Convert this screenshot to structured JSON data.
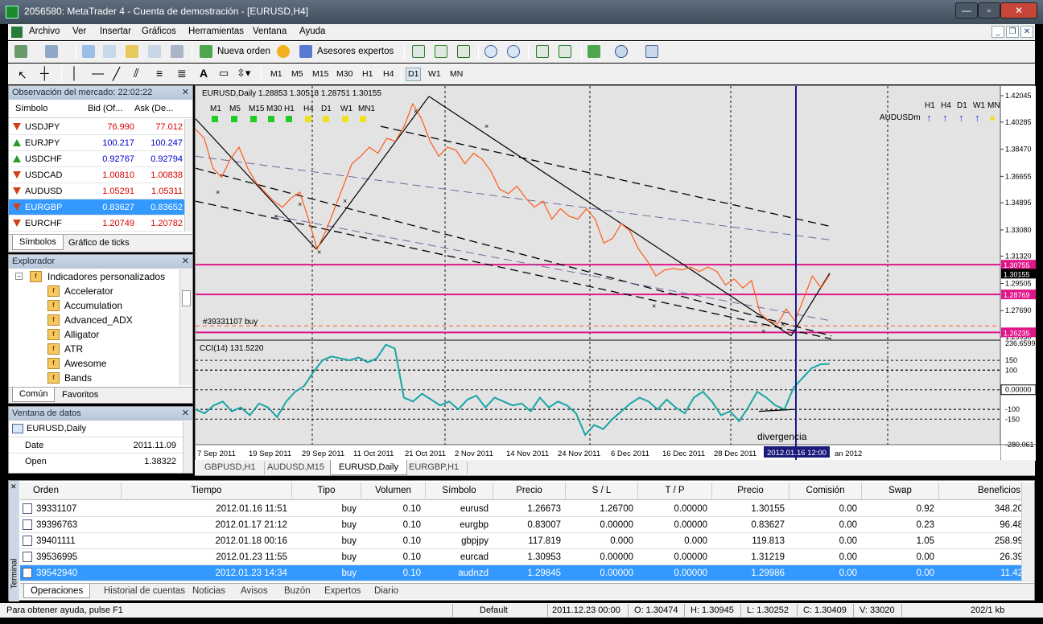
{
  "app": {
    "title": "2056580: MetaTrader 4 - Cuenta de demostración - [EURUSD,H4]"
  },
  "menu": [
    "Archivo",
    "Ver",
    "Insertar",
    "Gráficos",
    "Herramientas",
    "Ventana",
    "Ayuda"
  ],
  "toolbar": {
    "new_order": "Nueva orden",
    "experts": "Asesores expertos",
    "timeframes": [
      "M1",
      "M5",
      "M15",
      "M30",
      "H1",
      "H4",
      "D1",
      "W1",
      "MN"
    ]
  },
  "market_watch": {
    "title": "Observación del mercado: 22:02:22",
    "col_symbol": "Símbolo",
    "col_bid": "Bid (Of...",
    "col_ask": "Ask (De...",
    "rows": [
      {
        "symbol": "USDJPY",
        "bid": "76.990",
        "ask": "77.012",
        "dir": "down",
        "color": "#d80000"
      },
      {
        "symbol": "EURJPY",
        "bid": "100.217",
        "ask": "100.247",
        "dir": "up",
        "color": "#0000c8"
      },
      {
        "symbol": "USDCHF",
        "bid": "0.92767",
        "ask": "0.92794",
        "dir": "up",
        "color": "#0000c8"
      },
      {
        "symbol": "USDCAD",
        "bid": "1.00810",
        "ask": "1.00838",
        "dir": "down",
        "color": "#d80000"
      },
      {
        "symbol": "AUDUSD",
        "bid": "1.05291",
        "ask": "1.05311",
        "dir": "down",
        "color": "#d80000"
      },
      {
        "symbol": "EURGBP",
        "bid": "0.83627",
        "ask": "0.83652",
        "dir": "down",
        "color": "#ffffff"
      },
      {
        "symbol": "EURCHF",
        "bid": "1.20749",
        "ask": "1.20782",
        "dir": "down",
        "color": "#d80000"
      }
    ],
    "tab_symbols": "Símbolos",
    "tab_ticks": "Gráfico de ticks"
  },
  "navigator": {
    "title": "Explorador",
    "folder": "Indicadores personalizados",
    "items": [
      "Accelerator",
      "Accumulation",
      "Advanced_ADX",
      "Alligator",
      "ATR",
      "Awesome",
      "Bands"
    ],
    "tab_common": "Común",
    "tab_favorites": "Favoritos"
  },
  "data_window": {
    "title": "Ventana de datos",
    "symbol": "EURUSD,Daily",
    "rows": [
      {
        "label": "Date",
        "value": "2011.11.09"
      },
      {
        "label": "Open",
        "value": "1.38322"
      }
    ]
  },
  "chart": {
    "header": "EURUSD,Daily  1.28853 1.30518 1.28751 1.30155",
    "tf_labels": [
      "M1",
      "M5",
      "M15",
      "M30",
      "H1",
      "H4",
      "D1",
      "W1",
      "MN1"
    ],
    "audusd_label": "AUDUSDm",
    "audusd_tfs": [
      "H1",
      "H4",
      "D1",
      "W1",
      "MN"
    ],
    "order_label": "#39331107 buy",
    "price_ticks": [
      "1.42045",
      "1.40285",
      "1.38470",
      "1.36655",
      "1.34895",
      "1.33080",
      "1.31320",
      "1.29505",
      "1.27690",
      "1.25930"
    ],
    "price_tags": [
      {
        "text": "1.30755",
        "bg": "#e0168a"
      },
      {
        "text": "1.30155",
        "bg": "#000000"
      },
      {
        "text": "1.28769",
        "bg": "#e0168a"
      },
      {
        "text": "1.26235",
        "bg": "#e0168a"
      }
    ],
    "cci_label": "CCI(14) 131.5220",
    "cci_ticks": [
      "236.6599",
      "150",
      "100",
      "0.00000",
      "-100",
      "-150",
      "-280.061"
    ],
    "divergence": "divergencia",
    "date_ticks": [
      "7 Sep 2011",
      "19 Sep 2011",
      "29 Sep 2011",
      "11 Oct 2011",
      "21 Oct 2011",
      "2 Nov 2011",
      "14 Nov 2011",
      "24 Nov 2011",
      "6 Dec 2011",
      "16 Dec 2011",
      "28 Dec 2011",
      "an 2012"
    ],
    "cursor_date": "2012.01.16 12:00",
    "tabs": [
      "GBPUSD,H1",
      "AUDUSD,M15",
      "EURUSD,Daily",
      "EURGBP,H1"
    ],
    "active_tab": 2
  },
  "chart_data": {
    "type": "line",
    "title": "EURUSD,Daily",
    "ylim": [
      1.2593,
      1.42045
    ],
    "series": [
      {
        "name": "EURUSD",
        "values": [
          1.398,
          1.392,
          1.372,
          1.366,
          1.378,
          1.386,
          1.372,
          1.362,
          1.356,
          1.35,
          1.346,
          1.352,
          1.356,
          1.338,
          1.318,
          1.33,
          1.345,
          1.36,
          1.375,
          1.38,
          1.386,
          1.382,
          1.392,
          1.39,
          1.4,
          1.415,
          1.405,
          1.39,
          1.38,
          1.386,
          1.384,
          1.375,
          1.382,
          1.378,
          1.37,
          1.358,
          1.355,
          1.36,
          1.352,
          1.346,
          1.35,
          1.338,
          1.345,
          1.34,
          1.338,
          1.345,
          1.338,
          1.322,
          1.325,
          1.335,
          1.33,
          1.318,
          1.31,
          1.3,
          1.304,
          1.305,
          1.304,
          1.306,
          1.303,
          1.306,
          1.303,
          1.294,
          1.298,
          1.292,
          1.297,
          1.275,
          1.27,
          1.268,
          1.278,
          1.27,
          1.285,
          1.3,
          1.292,
          1.301
        ]
      },
      {
        "name": "CCI(14)",
        "values": [
          -100,
          -120,
          -80,
          -60,
          -110,
          -90,
          -130,
          -70,
          -90,
          -140,
          -60,
          -10,
          20,
          90,
          150,
          170,
          160,
          150,
          165,
          140,
          160,
          230,
          210,
          -40,
          -60,
          -20,
          -50,
          -80,
          -60,
          -100,
          -50,
          -30,
          -90,
          -40,
          -60,
          -80,
          -70,
          -110,
          -40,
          -90,
          -60,
          -80,
          -120,
          -230,
          -180,
          -200,
          -150,
          -110,
          -70,
          -40,
          -60,
          -100,
          -50,
          -90,
          -120,
          -40,
          -10,
          -60,
          -130,
          -110,
          -160,
          -90,
          -10,
          -40,
          -80,
          -100,
          10,
          60,
          110,
          130,
          131.522
        ]
      }
    ],
    "cci_ylim": [
      -280.061,
      236.6599
    ]
  },
  "terminal": {
    "side_label": "Terminal",
    "headers": [
      "Orden",
      "Tiempo",
      "Tipo",
      "Volumen",
      "Símbolo",
      "Precio",
      "S / L",
      "T / P",
      "Precio",
      "Comisión",
      "Swap",
      "Beneficios"
    ],
    "rows": [
      [
        "39331107",
        "2012.01.16 11:51",
        "buy",
        "0.10",
        "eurusd",
        "1.26673",
        "1.26700",
        "0.00000",
        "1.30155",
        "0.00",
        "0.92",
        "348.20"
      ],
      [
        "39396763",
        "2012.01.17 21:12",
        "buy",
        "0.10",
        "eurgbp",
        "0.83007",
        "0.00000",
        "0.00000",
        "0.83627",
        "0.00",
        "0.23",
        "96.48"
      ],
      [
        "39401111",
        "2012.01.18 00:16",
        "buy",
        "0.10",
        "gbpjpy",
        "117.819",
        "0.000",
        "0.000",
        "119.813",
        "0.00",
        "1.05",
        "258.99"
      ],
      [
        "39536995",
        "2012.01.23 11:55",
        "buy",
        "0.10",
        "eurcad",
        "1.30953",
        "0.00000",
        "0.00000",
        "1.31219",
        "0.00",
        "0.00",
        "26.39"
      ],
      [
        "39542940",
        "2012.01.23 14:34",
        "buy",
        "0.10",
        "audnzd",
        "1.29845",
        "0.00000",
        "0.00000",
        "1.29986",
        "0.00",
        "0.00",
        "11.42"
      ]
    ],
    "selected_row": 4,
    "tabs": [
      "Operaciones",
      "Historial de cuentas",
      "Noticias",
      "Avisos",
      "Buzón",
      "Expertos",
      "Diario"
    ]
  },
  "status": {
    "help": "Para obtener ayuda, pulse F1",
    "profile": "Default",
    "datetime": "2011.12.23 00:00",
    "open": "O: 1.30474",
    "high": "H: 1.30945",
    "low": "L: 1.30252",
    "close": "C: 1.30409",
    "volume": "V: 33020",
    "traffic": "202/1 kb"
  },
  "colors": {
    "price_line": "#ff5a1a",
    "cci_line": "#1aa5a5",
    "level_line": "#e0168a",
    "cursor_line": "#1a1a8a",
    "chart_bg": "#e3e3e3",
    "selection": "#3399ff"
  }
}
